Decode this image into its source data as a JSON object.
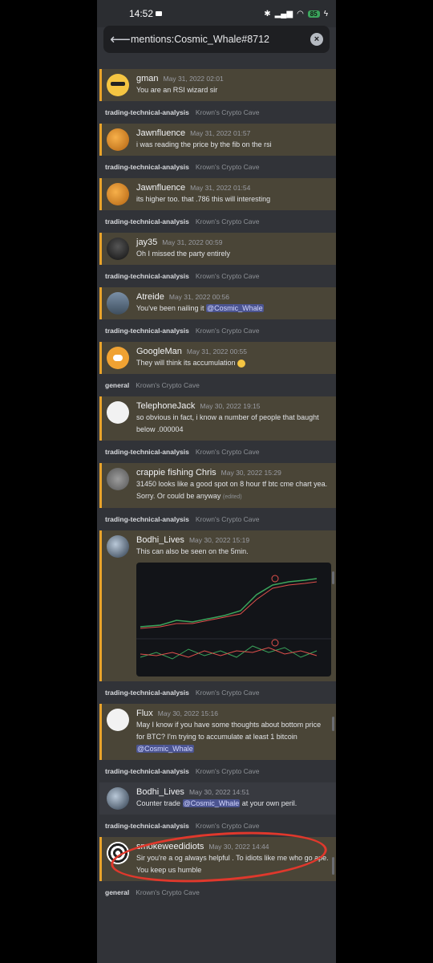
{
  "status_bar": {
    "time": "14:52",
    "battery": "85"
  },
  "search": {
    "query": "mentions:Cosmic_Whale#8712",
    "back_icon": "arrow-left-icon",
    "clear_icon": "close-icon"
  },
  "messages": [
    {
      "channel": "",
      "server": "",
      "user": "gman",
      "time": "May 31, 2022 02:01",
      "text": "You are an RSI wizard sir",
      "avatar": "sunglasses-emoji"
    },
    {
      "channel": "trading-technical-analysis",
      "server": "Krown's Crypto Cave",
      "user": "Jawnfluence",
      "time": "May 31, 2022 01:57",
      "text": "i was reading the price by the fib on the rsi",
      "avatar": "orange"
    },
    {
      "channel": "trading-technical-analysis",
      "server": "Krown's Crypto Cave",
      "user": "Jawnfluence",
      "time": "May 31, 2022 01:54",
      "text": "its higher too. that .786 this will interesting",
      "avatar": "orange"
    },
    {
      "channel": "trading-technical-analysis",
      "server": "Krown's Crypto Cave",
      "user": "jay35",
      "time": "May 31, 2022 00:59",
      "text": "Oh I missed the party entirely",
      "avatar": "dark"
    },
    {
      "channel": "trading-technical-analysis",
      "server": "Krown's Crypto Cave",
      "user": "Atreide",
      "time": "May 31, 2022 00:56",
      "text": "You've been nailing it",
      "mention": "@Cosmic_Whale",
      "avatar": "landscape"
    },
    {
      "channel": "trading-technical-analysis",
      "server": "Krown's Crypto Cave",
      "user": "GoogleMan",
      "time": "May 31, 2022 00:55",
      "text": "They will think its accumulation",
      "emoji": "grin-emoji",
      "avatar": "discord"
    },
    {
      "channel": "general",
      "server": "Krown's Crypto Cave",
      "user": "TelephoneJack",
      "time": "May 30, 2022 19:15",
      "text": "so obvious in fact, i know a number of people that baught below .000004",
      "avatar": "white"
    },
    {
      "channel": "trading-technical-analysis",
      "server": "Krown's Crypto Cave",
      "user": "crappie fishing Chris",
      "time": "May 30, 2022 15:29",
      "text": "31450 looks like a good spot on 8 hour tf btc cme chart yea.   Sorry.   Or could be anyway",
      "edited": "(edited)",
      "avatar": "gray"
    },
    {
      "channel": "trading-technical-analysis",
      "server": "Krown's Crypto Cave",
      "user": "Bodhi_Lives",
      "time": "May 30, 2022 15:19",
      "text": "This can also be seen on the 5min.",
      "image": "trading-chart",
      "avatar": "blue"
    },
    {
      "channel": "trading-technical-analysis",
      "server": "Krown's Crypto Cave",
      "user": "Flux",
      "time": "May 30, 2022 15:16",
      "text": "May I know if you have some thoughts about bottom price for BTC? I'm trying to accumulate at least 1 bitcoin",
      "mention": "@Cosmic_Whale",
      "avatar": "white"
    },
    {
      "channel": "trading-technical-analysis",
      "server": "Krown's Crypto Cave",
      "user": "Bodhi_Lives",
      "time": "May 30, 2022 14:51",
      "text": "Counter trade",
      "mention": "@Cosmic_Whale",
      "text_after": "at your own peril.",
      "avatar": "blue",
      "highlighted": true
    },
    {
      "channel": "trading-technical-analysis",
      "server": "Krown's Crypto Cave",
      "user": "smokeweedidiots",
      "time": "May 30, 2022 14:44",
      "text": "Sir you're a og always helpful . To idiots like me who go ape. You keep us humble",
      "avatar": "pattern"
    },
    {
      "channel": "general",
      "server": "Krown's Crypto Cave",
      "user": "",
      "time": "",
      "text": "",
      "avatar": ""
    }
  ],
  "colors": {
    "background": "#313338",
    "highlight": "#4a4537",
    "highlight_border": "#e9a32a",
    "mention_bg": "#4b5490",
    "annotation": "#e0382c"
  }
}
